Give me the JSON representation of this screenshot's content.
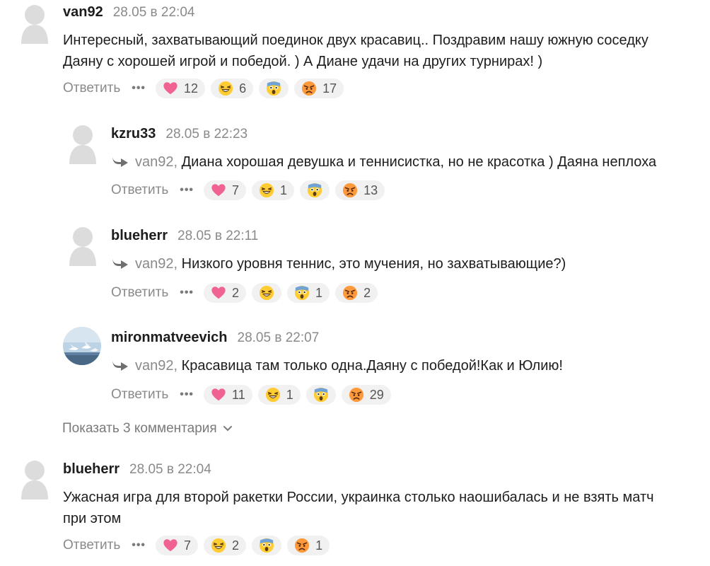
{
  "reply_label": "Ответить",
  "more_dots": "•••",
  "comments": [
    {
      "user": "van92",
      "date": "28.05 в 22:04",
      "text_line1": "Интересный, захватывающий поединок двух красавиц.. Поздравим нашу южную соседку",
      "text_line2": "Даяну с хорошей игрой и победой. ) А Диане удачи на других турнирах! )",
      "reactions": {
        "heart": "12",
        "laugh": "6",
        "shock": "",
        "angry": "17"
      }
    },
    {
      "user": "kzru33",
      "date": "28.05 в 22:23",
      "mention": "van92,",
      "text": "Диана хорошая девушка и теннисистка, но не красотка ) Даяна неплоха",
      "reactions": {
        "heart": "7",
        "laugh": "1",
        "shock": "",
        "angry": "13"
      }
    },
    {
      "user": "blueherr",
      "date": "28.05 в 22:11",
      "mention": "van92,",
      "text": "Низкого уровня теннис, это мучения, но захватывающие?)",
      "reactions": {
        "heart": "2",
        "laugh": "",
        "shock": "1",
        "angry": "2"
      }
    },
    {
      "user": "mironmatveevich",
      "date": "28.05 в 22:07",
      "mention": "van92,",
      "text": "Красавица там только одна.Даяну с победой!Как и Юлию!",
      "reactions": {
        "heart": "11",
        "laugh": "1",
        "shock": "",
        "angry": "29"
      }
    },
    {
      "user": "blueherr",
      "date": "28.05 в 22:04",
      "text_line1": "Ужасная игра для второй ракетки России, украинка столько наошибалась и не взять матч",
      "text_line2": "при этом",
      "reactions": {
        "heart": "7",
        "laugh": "2",
        "shock": "",
        "angry": "1"
      }
    }
  ],
  "show_more_label": "Показать 3 комментария",
  "icons": {
    "avatar": "default-avatar-icon",
    "reply_arrow": "reply-arrow-icon",
    "heart": "heart-emoji-icon",
    "laugh": "laughing-emoji-icon",
    "shock": "shocked-emoji-icon",
    "angry": "angry-emoji-icon",
    "chevron": "chevron-down-icon"
  },
  "colors": {
    "text": "#1d1d1d",
    "muted": "#8a8a8a",
    "chip_bg": "#f1f1f1",
    "heart": "#f06292"
  }
}
